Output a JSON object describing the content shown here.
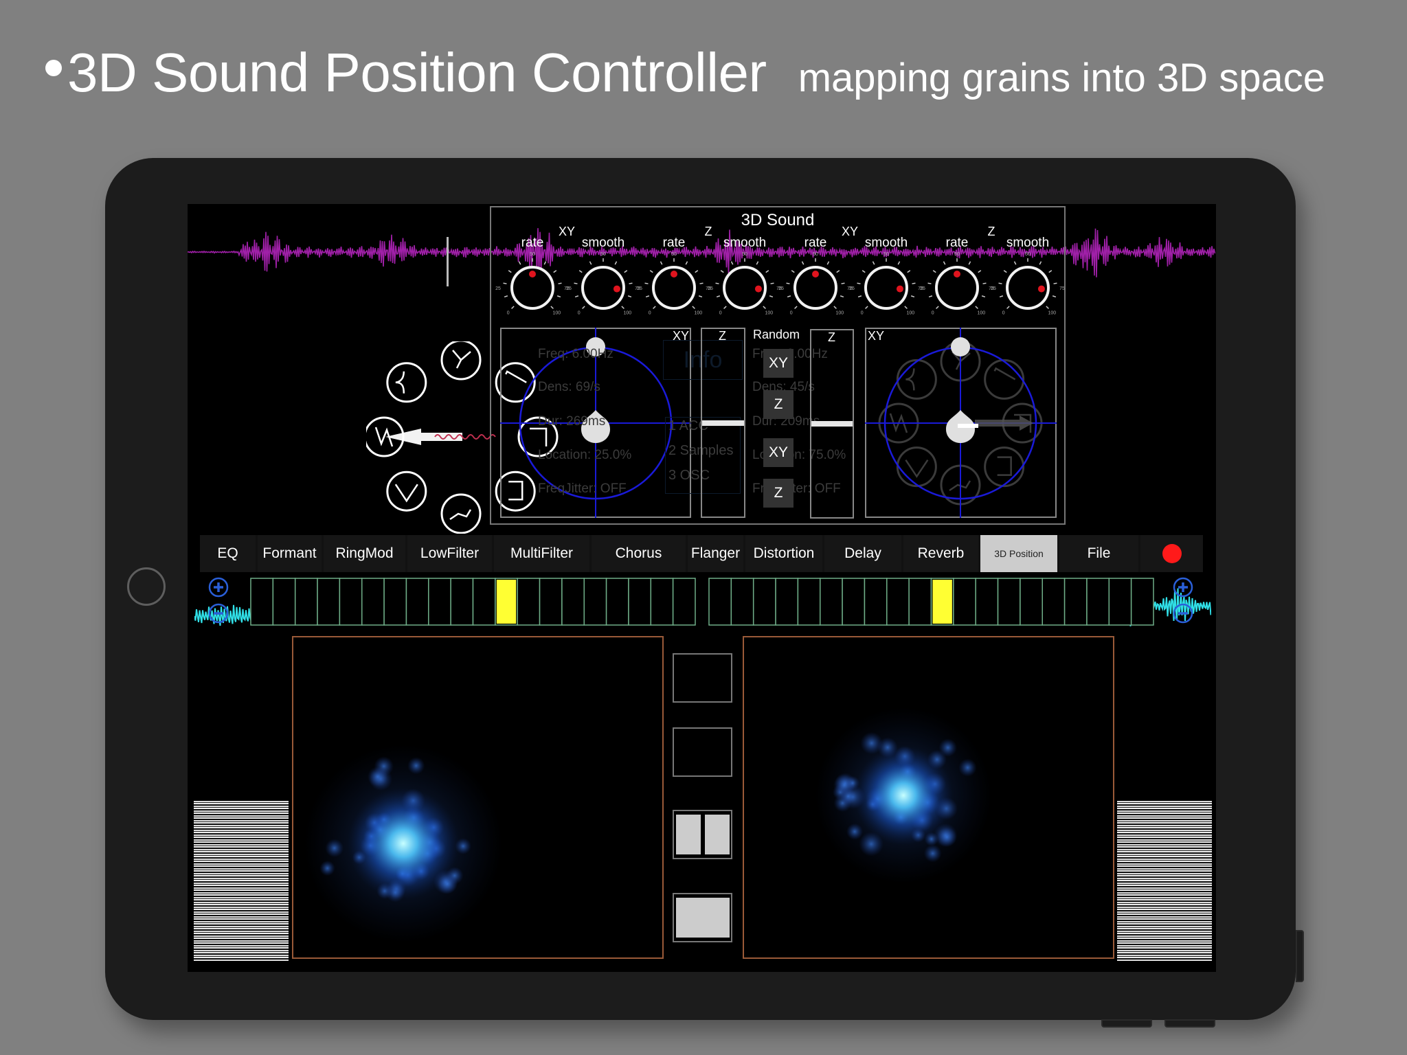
{
  "headline": {
    "title": "3D Sound Position Controller",
    "subtitle": "mapping grains into 3D space"
  },
  "sound3d_panel": {
    "title": "3D Sound",
    "groups": [
      {
        "axis": "XY",
        "knobs": [
          {
            "label": "rate",
            "value": 50
          },
          {
            "label": "smooth",
            "value": 85
          }
        ]
      },
      {
        "axis": "Z",
        "knobs": [
          {
            "label": "rate",
            "value": 50
          },
          {
            "label": "smooth",
            "value": 85
          }
        ]
      },
      {
        "axis": "XY",
        "knobs": [
          {
            "label": "rate",
            "value": 50
          },
          {
            "label": "smooth",
            "value": 85
          }
        ]
      },
      {
        "axis": "Z",
        "knobs": [
          {
            "label": "rate",
            "value": 50
          },
          {
            "label": "smooth",
            "value": 85
          }
        ]
      }
    ],
    "knob_scale": {
      "min": "0",
      "q1": "25",
      "mid": "50",
      "q3": "75",
      "max": "100"
    },
    "left_xy_label": "XY",
    "left_z_label": "Z",
    "random_label": "Random",
    "right_z_label": "Z",
    "right_xy_label": "XY",
    "random_buttons": [
      "XY",
      "Z",
      "XY",
      "Z"
    ],
    "left_z_slider_value": 0.5,
    "right_z_slider_value": 0.5
  },
  "ghost_info_left": {
    "freq": "Freq: 6.00Hz",
    "dens": "Dens: 69/s",
    "dur": "Dur: 269ms",
    "location": "Location: 25.0%",
    "jitter": "FreqJitter: OFF"
  },
  "ghost_info_right": {
    "freq": "Freq: 6.00Hz",
    "dens": "Dens: 45/s",
    "dur": "Dur: 209ms",
    "location": "Location: 75.0%",
    "jitter": "FreqJitter: OFF"
  },
  "ghost_menu": {
    "info": "Info",
    "items": [
      "1 ACC",
      "2 Samples",
      "3 OSC"
    ]
  },
  "effects_tabs": [
    {
      "label": "EQ"
    },
    {
      "label": "Formant"
    },
    {
      "label": "RingMod"
    },
    {
      "label": "LowFilter"
    },
    {
      "label": "MultiFilter"
    },
    {
      "label": "Chorus"
    },
    {
      "label": "Flanger"
    },
    {
      "label": "Distortion"
    },
    {
      "label": "Delay"
    },
    {
      "label": "Reverb"
    },
    {
      "label": "3D Position",
      "active": true
    },
    {
      "label": "File"
    }
  ],
  "record_color": "#ff1a1a",
  "step_sequencers": [
    {
      "steps": 20,
      "active_step": 11
    },
    {
      "steps": 20,
      "active_step": 10
    }
  ],
  "colors": {
    "waveform_top": "#a020a8",
    "waveform_mid": "#30e0e8",
    "xy_circle": "#1a1ad8",
    "step_border": "#6fae88",
    "step_active": "#ffff33",
    "panel_border": "#9a5a38",
    "blob": "#2f8cff"
  },
  "layout_buttons": [
    "empty",
    "empty",
    "split",
    "single"
  ]
}
